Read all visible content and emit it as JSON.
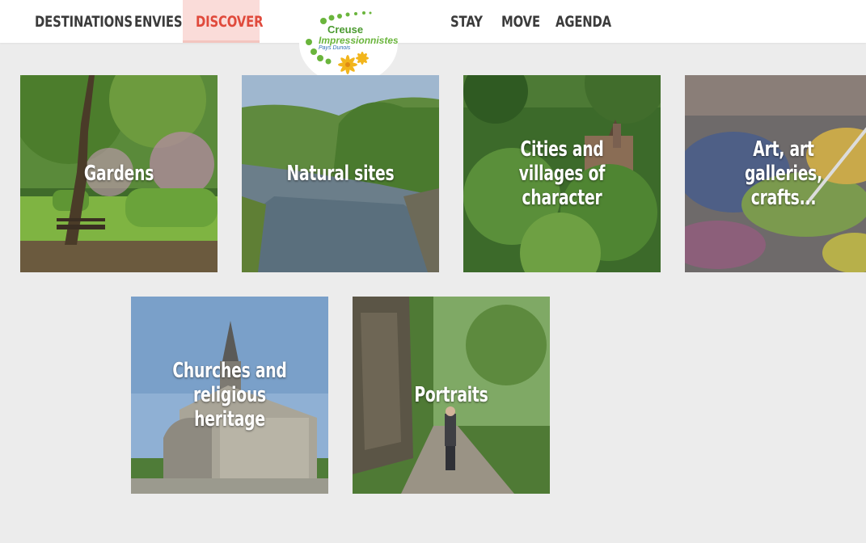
{
  "nav": {
    "left": [
      "DESTINATIONS",
      "ENVIES",
      "DISCOVER"
    ],
    "right": [
      "STAY",
      "MOVE",
      "AGENDA"
    ],
    "active": "DISCOVER",
    "active_color": "#e04a3c",
    "active_bg": "#fadcd9"
  },
  "logo": {
    "line1": "Creuse",
    "line2": "Impressionnistes",
    "line3": "Pays Dunois"
  },
  "tiles": [
    {
      "label": "Gardens",
      "icon": "garden-photo"
    },
    {
      "label": "Natural sites",
      "icon": "river-photo"
    },
    {
      "label": "Cities and villages of character",
      "icon": "village-photo"
    },
    {
      "label": "Art, art galleries, crafts...",
      "icon": "palette-photo"
    },
    {
      "label": "Churches and religious heritage",
      "icon": "church-photo"
    },
    {
      "label": "Portraits",
      "icon": "forest-path-photo"
    }
  ]
}
